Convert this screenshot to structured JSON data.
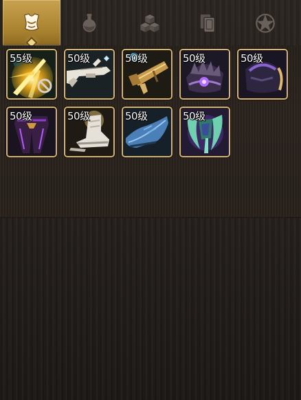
{
  "tabs": [
    {
      "name": "equipment",
      "icon": "armor-icon",
      "active": true
    },
    {
      "name": "potions",
      "icon": "potion-flask-icon",
      "active": false
    },
    {
      "name": "materials",
      "icon": "cubes-icon",
      "active": false
    },
    {
      "name": "cards",
      "icon": "cards-icon",
      "active": false
    },
    {
      "name": "special",
      "icon": "pentagram-star-icon",
      "active": false
    }
  ],
  "items": [
    {
      "level": "55级",
      "icon": "golden-sword-slash-icon"
    },
    {
      "level": "50级",
      "icon": "white-flintlock-gun-icon"
    },
    {
      "level": "50级",
      "icon": "golden-cannon-blaster-icon"
    },
    {
      "level": "50级",
      "icon": "purple-spiked-shoulder-armor-icon"
    },
    {
      "level": "50级",
      "icon": "purple-horned-helmet-icon"
    },
    {
      "level": "50级",
      "icon": "dark-purple-pants-icon"
    },
    {
      "level": "50级",
      "icon": "white-boots-icon"
    },
    {
      "level": "50级",
      "icon": "blue-shoes-icon"
    },
    {
      "level": "50级",
      "icon": "green-claw-gauntlet-icon"
    }
  ],
  "colors": {
    "accent_gold": "#d9b56a",
    "active_tab": "#b78f3c",
    "background": "#231e1b"
  }
}
